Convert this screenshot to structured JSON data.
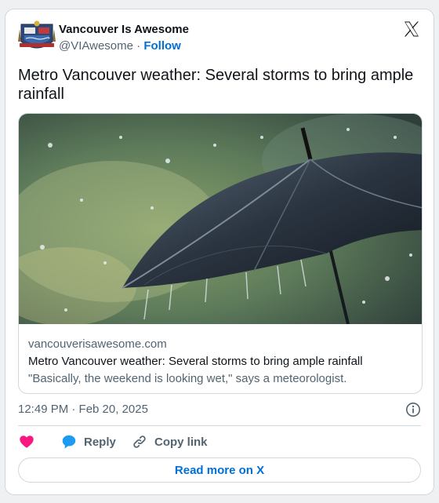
{
  "author": {
    "name": "Vancouver Is Awesome",
    "handle": "@VIAwesome",
    "separator": "·",
    "follow_label": "Follow"
  },
  "tweet": {
    "text": "Metro Vancouver weather: Several storms to bring ample rainfall",
    "timestamp": "12:49 PM · Feb 20, 2025"
  },
  "link_card": {
    "domain": "vancouverisawesome.com",
    "title": "Metro Vancouver weather: Several storms to bring ample rainfall",
    "description": "\"Basically, the weekend is looking wet,\" says a meteorologist.",
    "image_subject": "black umbrella in heavy rain"
  },
  "actions": {
    "like_icon": "heart-icon",
    "reply_label": "Reply",
    "copy_label": "Copy link"
  },
  "footer": {
    "read_more_label": "Read more on X"
  },
  "colors": {
    "accent_blue": "#006fd6",
    "like_pink": "#f91880",
    "reply_blue": "#1d9bf0",
    "muted": "#536471",
    "border": "#cfd9de"
  }
}
